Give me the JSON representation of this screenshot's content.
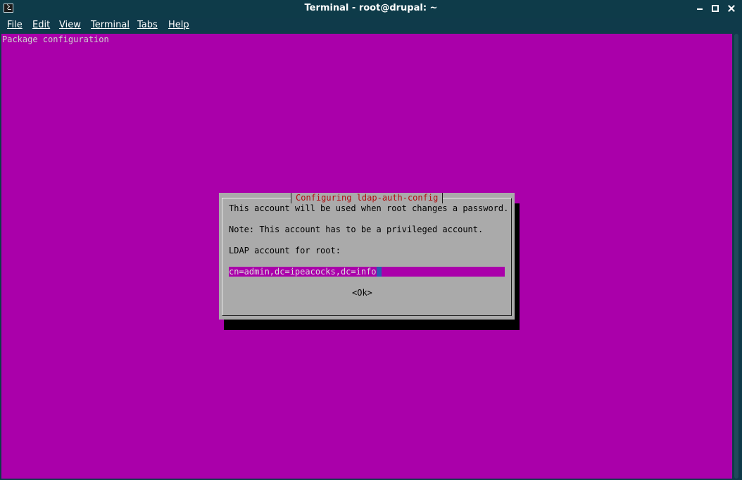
{
  "window": {
    "title": "Terminal - root@drupal: ~"
  },
  "menu": {
    "file": "File",
    "edit": "Edit",
    "view": "View",
    "terminal": "Terminal",
    "tabs": "Tabs",
    "help": "Help"
  },
  "terminal": {
    "header": "Package configuration"
  },
  "dialog": {
    "title": "Configuring ldap-auth-config",
    "line1": "This account will be used when root changes a password.",
    "line2": "Note: This account has to be a privileged account.",
    "line3": "LDAP account for root:",
    "input_value": "cn=admin,dc=ipeacocks,dc=info",
    "ok_label": "<Ok>"
  },
  "colors": {
    "terminal_bg": "#aa00aa",
    "dialog_bg": "#aaaaaa",
    "title_red": "#b01010",
    "titlebar_bg": "#0e3b49"
  },
  "icons": {
    "app": "terminal-icon",
    "minimize": "minimize-icon",
    "maximize": "maximize-icon",
    "close": "close-icon"
  }
}
